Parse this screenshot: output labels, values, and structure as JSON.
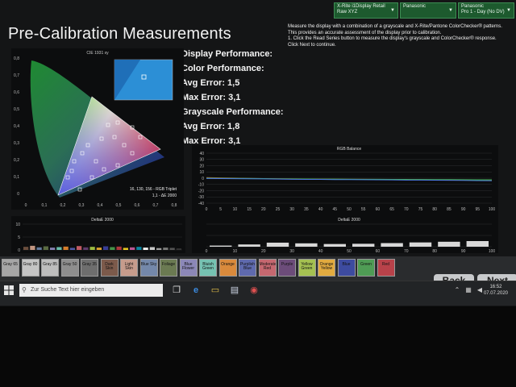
{
  "title": "Pre-Calibration Measurements",
  "dropdowns": [
    {
      "line1": "X-Rite i1Display Retail",
      "line2": "Raw XYZ"
    },
    {
      "line1": "Panasonic",
      "line2": ""
    },
    {
      "line1": "Panasonic",
      "line2": "Pro 1 - Day (No DV)"
    }
  ],
  "instructions": [
    "Measure the display with a combination of a grayscale and X-Rite/Pantone ColorChecker® patterns.",
    "This provides an accurate assessment of the display prior to calibration.",
    "1. Click the Read Series button to measure the display's grayscale and ColorChecker® response.",
    "Click Next to continue."
  ],
  "performance": {
    "display_label": "Display Performance:",
    "color_label": "Color Performance:",
    "color_avg": "Avg Error: 1,5",
    "color_max": "Max Error: 3,1",
    "gray_label": "Grayscale Performance:",
    "gray_avg": "Avg Error: 1,8",
    "gray_max": "Max Error: 3,1"
  },
  "cie_chart": {
    "title": "CIE 1931 xy",
    "readout_rgb": "16, 130, 156 - RGB Triplet",
    "readout_de": "1,1 - ΔE 2000",
    "x_ticks": [
      "0",
      "0,1",
      "0,2",
      "0,3",
      "0,4",
      "0,5",
      "0,6",
      "0,7",
      "0,8"
    ],
    "y_ticks": [
      "0,8",
      "0,7",
      "0,6",
      "0,5",
      "0,4",
      "0,3",
      "0,2",
      "0,1",
      "0"
    ]
  },
  "chart_data": [
    {
      "type": "line",
      "title": "RGB Balance",
      "x": [
        0,
        5,
        10,
        15,
        20,
        25,
        30,
        35,
        40,
        45,
        50,
        55,
        60,
        65,
        70,
        75,
        80,
        85,
        90,
        95,
        100
      ],
      "ylim": [
        -40,
        40
      ],
      "y_ticks": [
        40,
        30,
        20,
        10,
        0,
        -10,
        -20,
        -30,
        -40
      ],
      "series": [
        {
          "color": "#d33a3a",
          "values": [
            1,
            0.5,
            0.2,
            -0.3,
            -0.6,
            -1,
            -1.2,
            -1.3,
            -1.5,
            -1.6,
            -1.7,
            -1.8,
            -2,
            -2.1,
            -2.3,
            -2.4,
            -2.6,
            -2.8,
            -3,
            -3.1,
            -3.2
          ]
        },
        {
          "color": "#3fb24a",
          "values": [
            0.3,
            0,
            -0.2,
            -0.4,
            -0.7,
            -0.9,
            -1.1,
            -1.3,
            -1.4,
            -1.5,
            -1.6,
            -1.7,
            -1.8,
            -1.9,
            -2,
            -2.1,
            -2.2,
            -2.3,
            -2.4,
            -2.5,
            -2.6
          ]
        },
        {
          "color": "#4a78e0",
          "values": [
            -0.5,
            -0.6,
            -0.8,
            -1,
            -1.2,
            -1.5,
            -1.7,
            -1.9,
            -2,
            -2.2,
            -2.3,
            -2.4,
            -2.6,
            -2.8,
            -3,
            -3.1,
            -3.3,
            -3.4,
            -3.6,
            -3.8,
            -4
          ]
        }
      ]
    },
    {
      "type": "bar",
      "title": "DeltaE 2000",
      "ylim": [
        0,
        10
      ],
      "y_ticks": [
        10,
        5,
        0
      ],
      "colors": [
        "#6b4e3d",
        "#c29682",
        "#627a9d",
        "#5a6b42",
        "#8580b1",
        "#67bdaa",
        "#d67e2c",
        "#505ba6",
        "#c15a63",
        "#5e3c6c",
        "#9dbc40",
        "#e0a32e",
        "#383d96",
        "#469449",
        "#af363c",
        "#e7c71f",
        "#bb5695",
        "#0885a1",
        "#f3f3f2",
        "#c8c8c8",
        "#a0a0a0",
        "#7a7a79",
        "#555555",
        "#343434"
      ],
      "values": [
        1.2,
        1.6,
        1.0,
        1.4,
        0.9,
        1.1,
        1.3,
        0.8,
        1.5,
        1.0,
        1.2,
        0.9,
        1.4,
        1.1,
        1.3,
        0.8,
        1.0,
        1.2,
        0.9,
        1.1,
        0.7,
        0.9,
        0.8,
        0.6
      ]
    },
    {
      "type": "bar",
      "title": "DeltaE 2000",
      "x_ticks": [
        "0",
        "10",
        "20",
        "30",
        "40",
        "50",
        "60",
        "70",
        "80",
        "90",
        "100"
      ],
      "ylim": [
        0,
        10
      ],
      "values": [
        0.5,
        1.0,
        1.8,
        1.5,
        1.2,
        1.3,
        1.6,
        1.9,
        2.2,
        2.5
      ]
    }
  ],
  "swatches": [
    {
      "label": "Gray 65",
      "color": "#a6a6a6"
    },
    {
      "label": "Gray 80",
      "color": "#c4c4c4"
    },
    {
      "label": "Gray 85",
      "color": "#bdbdbd"
    },
    {
      "label": "Gray 50",
      "color": "#8e8e8e"
    },
    {
      "label": "Gray 35",
      "color": "#6e6e6e"
    },
    {
      "label": "Dark Skin",
      "color": "#7c5a4b"
    },
    {
      "label": "Light Skin",
      "color": "#c69c8c"
    },
    {
      "label": "Blue Sky",
      "color": "#7488aa"
    },
    {
      "label": "Foliage",
      "color": "#6b7a52"
    },
    {
      "label": "Blue Flower",
      "color": "#8c88b8"
    },
    {
      "label": "Bluish Green",
      "color": "#76c2b2"
    },
    {
      "label": "Orange",
      "color": "#d98a3c"
    },
    {
      "label": "Purplish Blue",
      "color": "#5f6aae"
    },
    {
      "label": "Moderate Red",
      "color": "#c56870"
    },
    {
      "label": "Purple",
      "color": "#6c4c7a"
    },
    {
      "label": "Yellow Green",
      "color": "#a5c152"
    },
    {
      "label": "Orange Yellow",
      "color": "#e2ab40"
    },
    {
      "label": "Blue",
      "color": "#3d4ba0"
    },
    {
      "label": "Green",
      "color": "#4f9c55"
    },
    {
      "label": "Red",
      "color": "#b8424a"
    }
  ],
  "nav": {
    "back": "Back",
    "next": "Next"
  },
  "taskbar": {
    "search_placeholder": "Zur Suche Text hier eingeben",
    "time": "16:52",
    "date": "07.07.2020"
  }
}
